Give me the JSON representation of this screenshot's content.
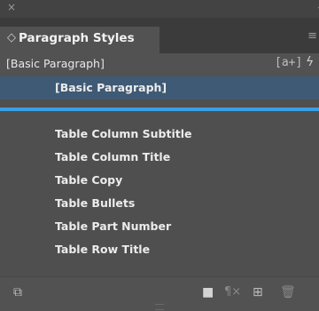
{
  "window": {
    "close_glyph": "×",
    "collapse_glyph": "‹"
  },
  "panel": {
    "tab_icon": "◇",
    "tab_title": "Paragraph Styles",
    "menu_icon": "≡"
  },
  "current_style": {
    "label": "[Basic Paragraph]",
    "new_override_glyph": "[a+]",
    "bolt_glyph": "ϟ"
  },
  "styles": [
    {
      "label": "[Basic Paragraph]",
      "selected": true
    },
    {
      "label": "",
      "selected": false
    },
    {
      "label": "Table Column Subtitle",
      "selected": false
    },
    {
      "label": "Table Column Title",
      "selected": false
    },
    {
      "label": "Table Copy",
      "selected": false
    },
    {
      "label": "Table Bullets",
      "selected": false
    },
    {
      "label": "Table Part Number",
      "selected": false
    },
    {
      "label": "Table Row Title",
      "selected": false
    }
  ],
  "footer": {
    "group_glyph": "⧉",
    "folder_glyph": "■",
    "clear_overrides_glyph": "¶×",
    "new_style_glyph": "⊞",
    "trash_glyph": "🗑"
  },
  "colors": {
    "selection": "#3e5a75",
    "drop_indicator": "#3aa0e6"
  }
}
